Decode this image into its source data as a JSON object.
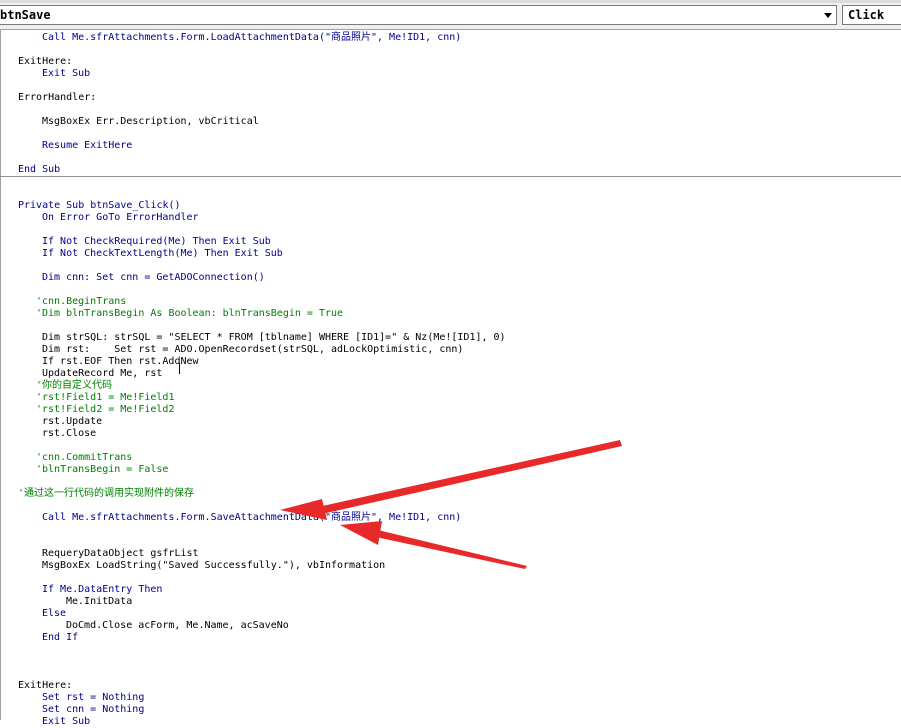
{
  "toolbar": {
    "object_combo": "btnSave",
    "procedure_combo": "Click"
  },
  "colors": {
    "keyword": "#00008b",
    "comment": "#008000",
    "arrow": "#e8292a"
  },
  "code": {
    "line01": "Call Me.sfrAttachments.Form.LoadAttachmentData(\"商品照片\", Me!ID1, cnn)",
    "line02": "ExitHere:",
    "line03": "Exit Sub",
    "line04": "ErrorHandler:",
    "line05": "MsgBoxEx Err.Description, vbCritical",
    "line06": "Resume ExitHere",
    "line07": "End Sub",
    "line08": "Private Sub btnSave_Click()",
    "line09": "On Error GoTo ErrorHandler",
    "line10": "If Not CheckRequired(Me) Then Exit Sub",
    "line11": "If Not CheckTextLength(Me) Then Exit Sub",
    "line12": "Dim cnn: Set cnn = GetADOConnection()",
    "line13": "'cnn.BeginTrans",
    "line14": "'Dim blnTransBegin As Boolean: blnTransBegin = True",
    "line15": "Dim strSQL: strSQL = \"SELECT * FROM [tblname] WHERE [ID1]=\" & Nz(Me![ID1], 0)",
    "line16": "Dim rst:    Set rst = ADO.OpenRecordset(strSQL, adLockOptimistic, cnn)",
    "line17": "If rst.EOF Then rst.AddNew",
    "line18": "UpdateRecord Me, rst",
    "line19": "'你的自定义代码",
    "line20": "'rst!Field1 = Me!Field1",
    "line21": "'rst!Field2 = Me!Field2",
    "line22": "rst.Update",
    "line23": "rst.Close",
    "line24": "'cnn.CommitTrans",
    "line25": "'blnTransBegin = False",
    "line26": "'通过这一行代码的调用实现附件的保存",
    "line27": "Call Me.sfrAttachments.Form.SaveAttachmentData(\"商品照片\", Me!ID1, cnn)",
    "line28": "RequeryDataObject gsfrList",
    "line29": "MsgBoxEx LoadString(\"Saved Successfully.\"), vbInformation",
    "line30": "If Me.DataEntry Then",
    "line31": "Me.InitData",
    "line32": "Else",
    "line33": "DoCmd.Close acForm, Me.Name, acSaveNo",
    "line34": "End If",
    "line35": "ExitHere:",
    "line36": "Set rst = Nothing",
    "line37": "Set cnn = Nothing",
    "line38": "Exit Sub"
  }
}
